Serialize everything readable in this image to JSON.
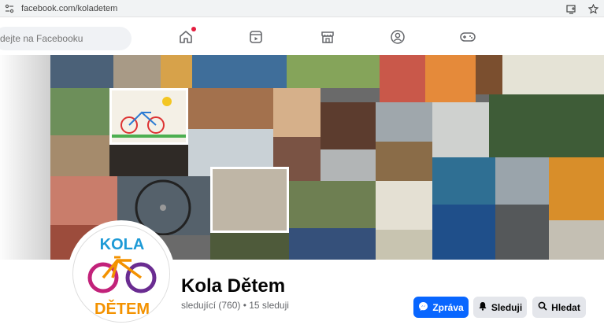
{
  "browser": {
    "url": "facebook.com/koladetem"
  },
  "header": {
    "search_placeholder": "dejte na Facebooku",
    "nav_icons": [
      "home-icon",
      "video-icon",
      "marketplace-icon",
      "groups-icon",
      "gaming-icon"
    ]
  },
  "colors": {
    "brand_blue": "#0866ff",
    "notification_red": "#e41e3f",
    "logo_pink": "#c2227a",
    "logo_orange": "#f39200",
    "logo_blue": "#1d9ad6",
    "logo_purple": "#6a2c91"
  },
  "profile": {
    "name": "Kola Dětem",
    "stats": "sledující (760) • 15 sleduji",
    "logo_text_top": "KOLA",
    "logo_text_bottom": "DĚTEM"
  },
  "actions": {
    "message_label": "Zpráva",
    "follow_label": "Sleduji",
    "search_label": "Hledat"
  }
}
